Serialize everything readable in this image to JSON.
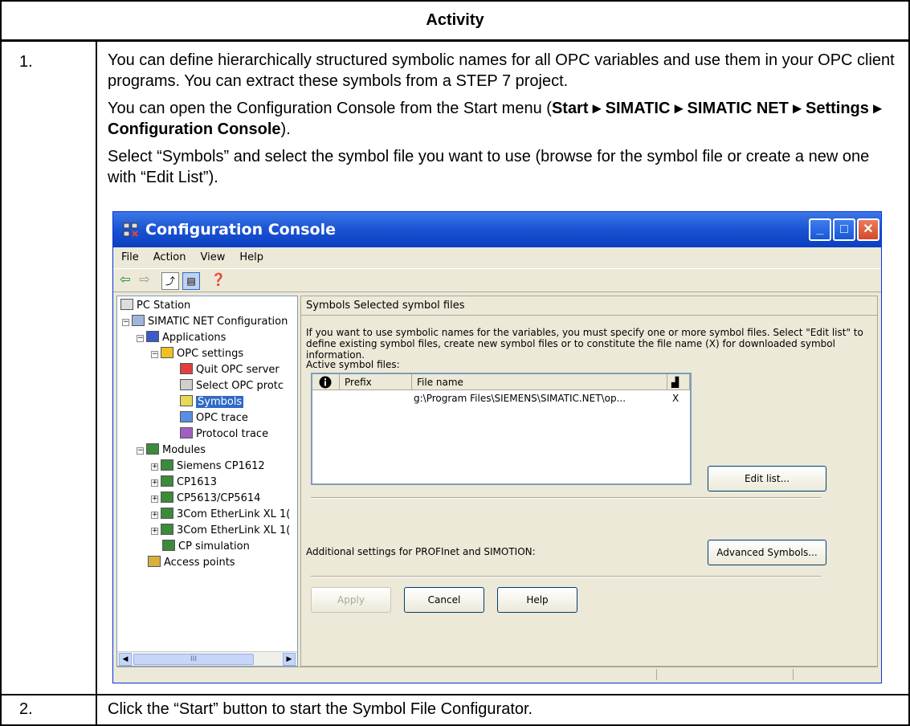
{
  "header": "Activity",
  "steps": [
    {
      "number": "1.",
      "para1": "You can define hierarchically structured symbolic names for all OPC variables and use them in your OPC client programs. You can extract these symbols from a STEP 7 project.",
      "para2_prefix": "You can open the Configuration Console from the Start menu (",
      "para2_bold": "Start ▸ SIMATIC ▸ SIMATIC NET ▸ Settings ▸ Configuration Console",
      "para2_suffix": ").",
      "para3": "Select “Symbols” and select the symbol file you want to use (browse for the symbol file or create a new one with “Edit List”)."
    },
    {
      "number": "2.",
      "text": "Click the “Start” button to start the Symbol File Configurator."
    }
  ],
  "window": {
    "title": "Configuration Console",
    "menu": [
      "File",
      "Action",
      "View",
      "Help"
    ],
    "tree": [
      "PC Station",
      "SIMATIC NET Configuration",
      "Applications",
      "OPC settings",
      "Quit OPC server",
      "Select OPC protc",
      "Symbols",
      "OPC trace",
      "Protocol trace",
      "Modules",
      "Siemens CP1612",
      "CP1613",
      "CP5613/CP5614",
      "3Com EtherLink XL 1(",
      "3Com EtherLink XL 1(",
      "CP simulation",
      "Access points"
    ],
    "tabs": "Symbols   Selected symbol files",
    "description": "If you want to use symbolic names for the variables, you must specify one or more symbol files. Select \"Edit list\" to define existing symbol files, create new symbol files or to constitute the file name (X) for downloaded symbol information.",
    "active_label": "Active symbol files:",
    "columns": {
      "prefix": "Prefix",
      "filename": "File name"
    },
    "row": {
      "filename": "g:\\Program Files\\SIEMENS\\SIMATIC.NET\\op...",
      "flag": "X"
    },
    "edit_list": "Edit list...",
    "additional_label": "Additional settings for PROFInet and SIMOTION:",
    "advanced": "Advanced Symbols...",
    "apply": "Apply",
    "cancel": "Cancel",
    "help": "Help"
  }
}
